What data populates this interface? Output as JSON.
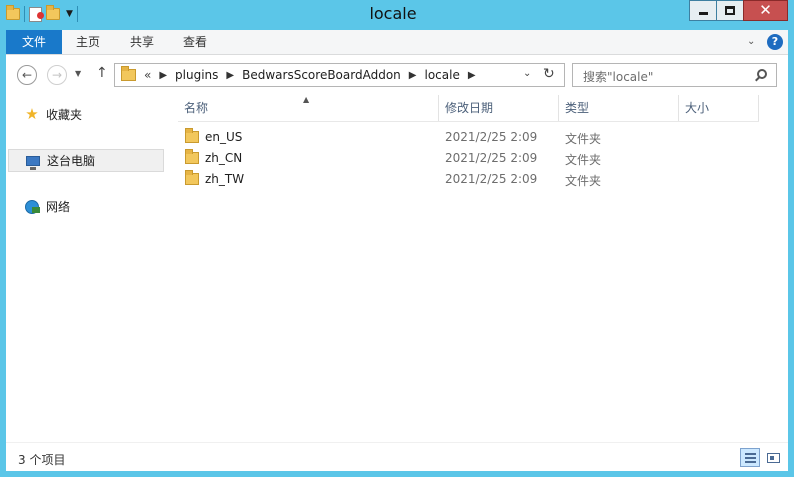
{
  "window": {
    "title": "locale"
  },
  "ribbon": {
    "tabs": [
      "文件",
      "主页",
      "共享",
      "查看"
    ],
    "help": "?"
  },
  "address": {
    "overflow": "«",
    "crumbs": [
      "plugins",
      "BedwarsScoreBoardAddon",
      "locale"
    ]
  },
  "search": {
    "placeholder": "搜索\"locale\""
  },
  "nav_pane": {
    "items": [
      "收藏夹",
      "这台电脑",
      "网络"
    ]
  },
  "columns": {
    "name": "名称",
    "date": "修改日期",
    "type": "类型",
    "size": "大小"
  },
  "files": [
    {
      "name": "en_US",
      "date": "2021/2/25 2:09",
      "type": "文件夹"
    },
    {
      "name": "zh_CN",
      "date": "2021/2/25 2:09",
      "type": "文件夹"
    },
    {
      "name": "zh_TW",
      "date": "2021/2/25 2:09",
      "type": "文件夹"
    }
  ],
  "status": {
    "count": "3 个项目"
  },
  "colors": {
    "titlebar": "#5bc6e8",
    "file_tab": "#1979ca",
    "close_button": "#c75050",
    "header_text": "#4c607a"
  }
}
